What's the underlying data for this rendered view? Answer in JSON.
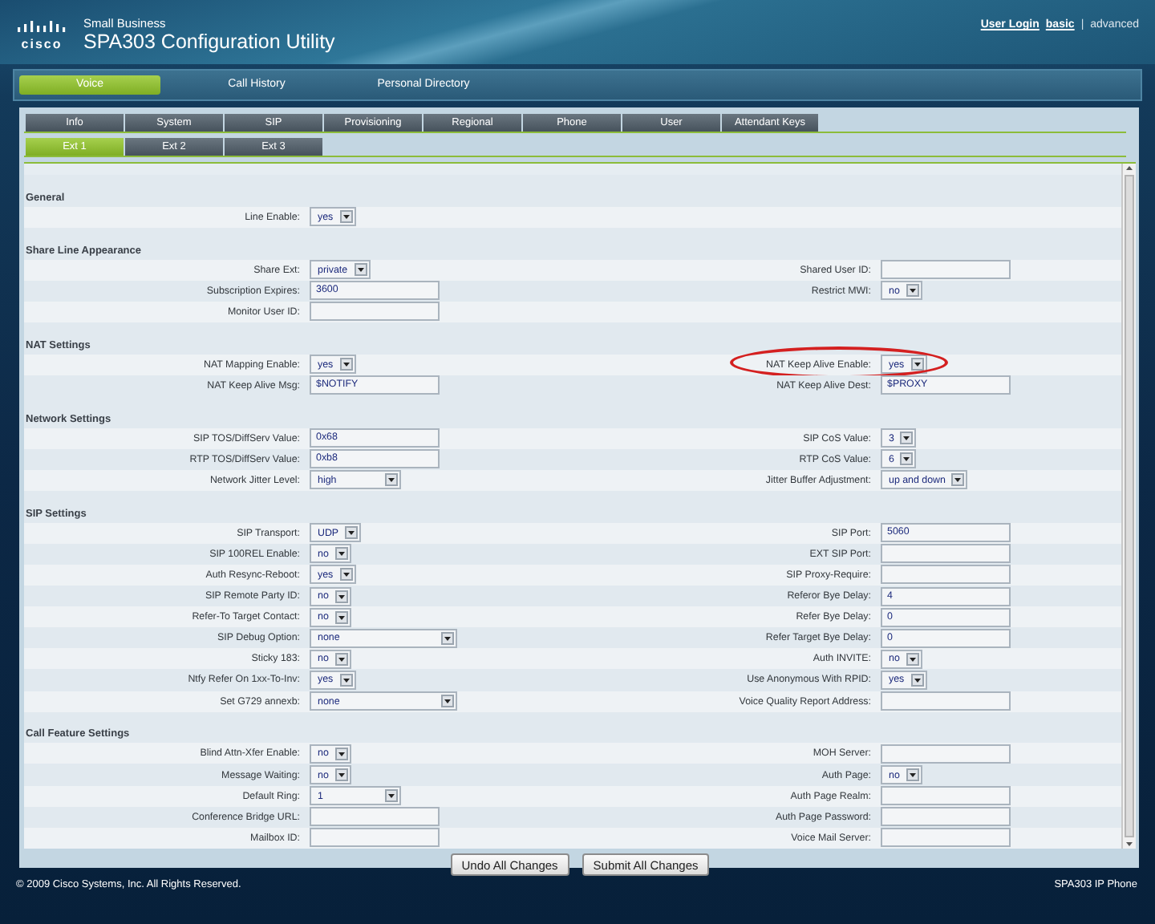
{
  "header": {
    "logo_word": "cisco",
    "subtitle": "Small Business",
    "title": "SPA303 Configuration Utility",
    "separator": "|",
    "links": [
      {
        "label": "User Login",
        "kind": "plain"
      },
      {
        "label": "basic",
        "kind": "mode",
        "selected": true
      },
      {
        "label": "advanced",
        "kind": "mode",
        "selected": false
      }
    ]
  },
  "nav_tabs": [
    {
      "label": "Voice",
      "selected": true
    },
    {
      "label": "Call History",
      "selected": false
    },
    {
      "label": "Personal Directory",
      "selected": false
    }
  ],
  "tabs": [
    {
      "label": "Info",
      "selected": false
    },
    {
      "label": "System",
      "selected": false
    },
    {
      "label": "SIP",
      "selected": false
    },
    {
      "label": "Provisioning",
      "selected": false
    },
    {
      "label": "Regional",
      "selected": false
    },
    {
      "label": "Phone",
      "selected": false
    },
    {
      "label": "User",
      "selected": false
    },
    {
      "label": "Attendant Keys",
      "selected": false
    }
  ],
  "ext_tabs": [
    {
      "label": "Ext 1",
      "selected": true
    },
    {
      "label": "Ext 2",
      "selected": false
    },
    {
      "label": "Ext 3",
      "selected": false
    }
  ],
  "sections": [
    {
      "title": "General",
      "rows": [
        {
          "left": {
            "label": "Line Enable:",
            "kind": "select",
            "value": "yes"
          }
        }
      ]
    },
    {
      "title": "Share Line Appearance",
      "rows": [
        {
          "left": {
            "label": "Share Ext:",
            "kind": "select",
            "value": "private"
          },
          "right": {
            "label": "Shared User ID:",
            "kind": "text"
          }
        },
        {
          "left": {
            "label": "Subscription Expires:",
            "kind": "text",
            "value": "3600"
          },
          "right": {
            "label": "Restrict MWI:",
            "kind": "select",
            "value": "no"
          }
        },
        {
          "left": {
            "label": "Monitor User ID:",
            "kind": "text"
          }
        }
      ]
    },
    {
      "title": "NAT Settings",
      "rows": [
        {
          "left": {
            "label": "NAT Mapping Enable:",
            "kind": "select",
            "value": "yes"
          },
          "right": {
            "label": "NAT Keep Alive Enable:",
            "kind": "select",
            "value": "yes",
            "highlighted": true
          }
        },
        {
          "left": {
            "label": "NAT Keep Alive Msg:",
            "kind": "text",
            "value": "$NOTIFY"
          },
          "right": {
            "label": "NAT Keep Alive Dest:",
            "kind": "text",
            "value": "$PROXY"
          }
        }
      ]
    },
    {
      "title": "Network Settings",
      "rows": [
        {
          "left": {
            "label": "SIP TOS/DiffServ Value:",
            "kind": "text",
            "value": "0x68"
          },
          "right": {
            "label": "SIP CoS Value:",
            "kind": "select",
            "value": "3"
          }
        },
        {
          "left": {
            "label": "RTP TOS/DiffServ Value:",
            "kind": "text",
            "value": "0xb8"
          },
          "right": {
            "label": "RTP CoS Value:",
            "kind": "select",
            "value": "6"
          }
        },
        {
          "left": {
            "label": "Network Jitter Level:",
            "kind": "select_medium",
            "value": "high"
          },
          "right": {
            "label": "Jitter Buffer Adjustment:",
            "kind": "select",
            "value": "up and down"
          }
        }
      ]
    },
    {
      "title": "SIP Settings",
      "rows": [
        {
          "left": {
            "label": "SIP Transport:",
            "kind": "select",
            "value": "UDP"
          },
          "right": {
            "label": "SIP Port:",
            "kind": "text",
            "value": "5060"
          }
        },
        {
          "left": {
            "label": "SIP 100REL Enable:",
            "kind": "select",
            "value": "no"
          },
          "right": {
            "label": "EXT SIP Port:",
            "kind": "text"
          }
        },
        {
          "left": {
            "label": "Auth Resync-Reboot:",
            "kind": "select",
            "value": "yes"
          },
          "right": {
            "label": "SIP Proxy-Require:",
            "kind": "text"
          }
        },
        {
          "left": {
            "label": "SIP Remote Party ID:",
            "kind": "select",
            "value": "no"
          },
          "right": {
            "label": "Referor Bye Delay:",
            "kind": "text",
            "value": "4"
          }
        },
        {
          "left": {
            "label": "Refer-To Target Contact:",
            "kind": "select",
            "value": "no"
          },
          "right": {
            "label": "Refer Bye Delay:",
            "kind": "text",
            "value": "0"
          }
        },
        {
          "left": {
            "label": "SIP Debug Option:",
            "kind": "select_wide",
            "value": "none"
          },
          "right": {
            "label": "Refer Target Bye Delay:",
            "kind": "text",
            "value": "0"
          }
        },
        {
          "left": {
            "label": "Sticky 183:",
            "kind": "select",
            "value": "no"
          },
          "right": {
            "label": "Auth INVITE:",
            "kind": "select",
            "value": "no"
          }
        },
        {
          "left": {
            "label": "Ntfy Refer On 1xx-To-Inv:",
            "kind": "select",
            "value": "yes"
          },
          "right": {
            "label": "Use Anonymous With RPID:",
            "kind": "select",
            "value": "yes"
          }
        },
        {
          "left": {
            "label": "Set G729 annexb:",
            "kind": "select_wide",
            "value": "none"
          },
          "right": {
            "label": "Voice Quality Report Address:",
            "kind": "text"
          }
        }
      ]
    },
    {
      "title": "Call Feature Settings",
      "rows": [
        {
          "left": {
            "label": "Blind Attn-Xfer Enable:",
            "kind": "select",
            "value": "no"
          },
          "right": {
            "label": "MOH Server:",
            "kind": "text"
          }
        },
        {
          "left": {
            "label": "Message Waiting:",
            "kind": "select",
            "value": "no"
          },
          "right": {
            "label": "Auth Page:",
            "kind": "select",
            "value": "no"
          }
        },
        {
          "left": {
            "label": "Default Ring:",
            "kind": "select_medium",
            "value": "1"
          },
          "right": {
            "label": "Auth Page Realm:",
            "kind": "text"
          }
        },
        {
          "left": {
            "label": "Conference Bridge URL:",
            "kind": "text"
          },
          "right": {
            "label": "Auth Page Password:",
            "kind": "text"
          }
        },
        {
          "left": {
            "label": "Mailbox ID:",
            "kind": "text"
          },
          "right": {
            "label": "Voice Mail Server:",
            "kind": "text"
          }
        }
      ]
    }
  ],
  "buttons": [
    "Undo All Changes",
    "Submit All Changes"
  ],
  "footer": {
    "copyright": "© 2009 Cisco Systems, Inc. All Rights Reserved.",
    "model": "SPA303 IP Phone"
  }
}
